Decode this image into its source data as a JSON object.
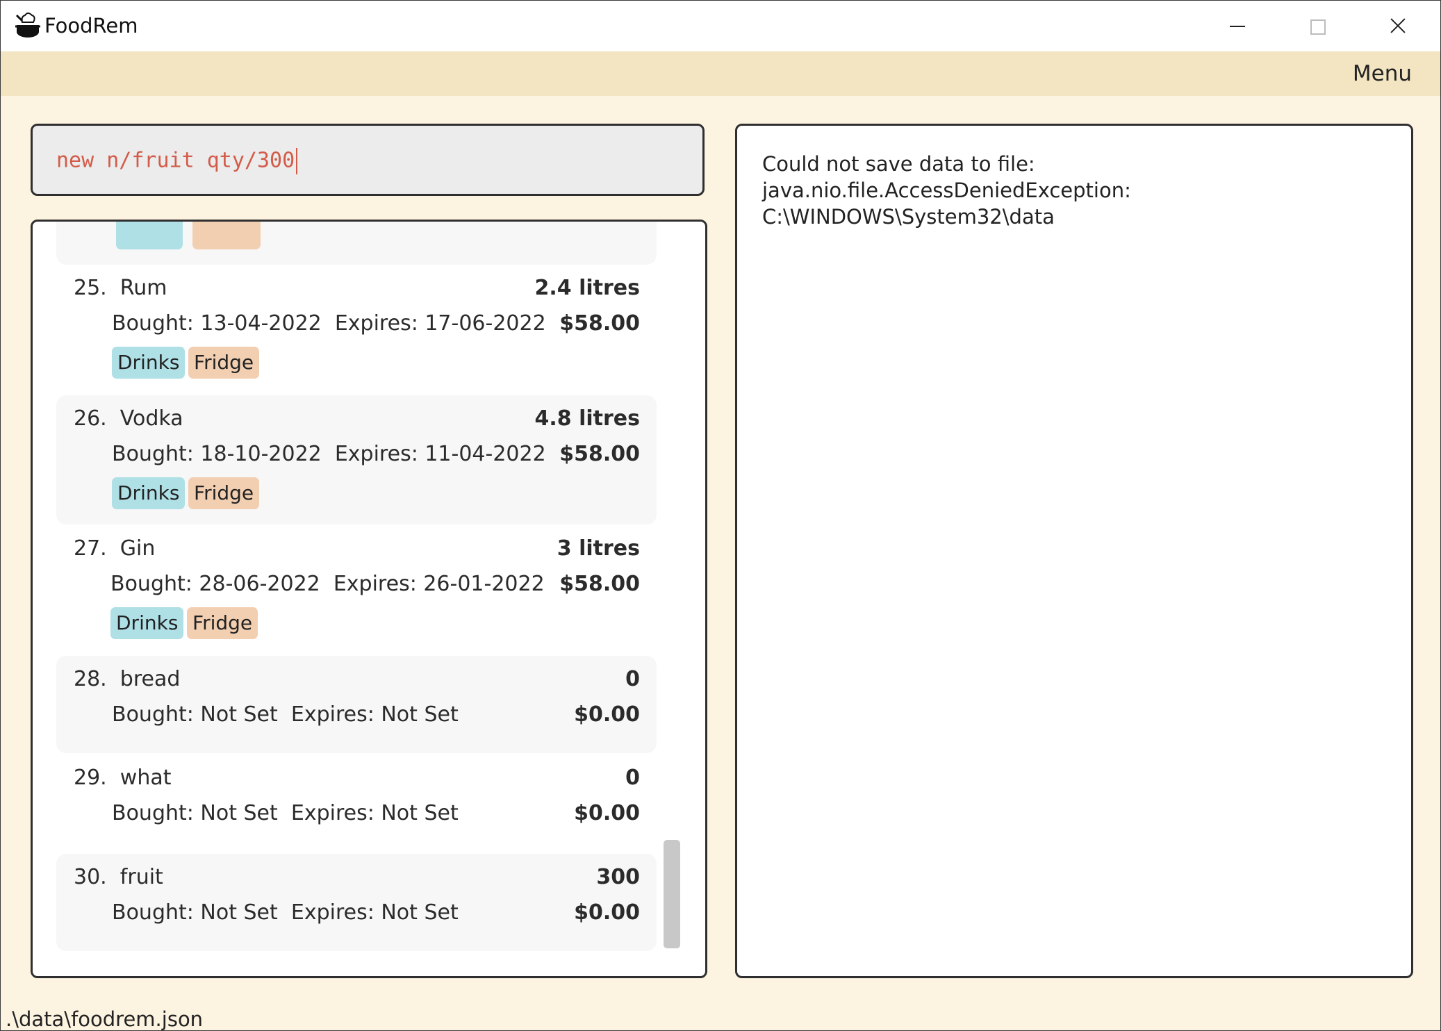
{
  "window": {
    "title": "FoodRem",
    "icon": "chef-pot-icon"
  },
  "menubar": {
    "menu_label": "Menu"
  },
  "command": {
    "value": "new n/fruit qty/300"
  },
  "result": {
    "line1": "Could not save data to file:",
    "line2": "java.nio.file.AccessDeniedException:",
    "line3": "C:\\WINDOWS\\System32\\data"
  },
  "items": [
    {
      "index": "25.",
      "name": "Rum",
      "quantity": "2.4 litres",
      "bought": "Bought: 13-04-2022",
      "expires": "Expires: 17-06-2022",
      "price": "$58.00",
      "tags": [
        "Drinks",
        "Fridge"
      ]
    },
    {
      "index": "26.",
      "name": "Vodka",
      "quantity": "4.8 litres",
      "bought": "Bought: 18-10-2022",
      "expires": "Expires: 11-04-2022",
      "price": "$58.00",
      "tags": [
        "Drinks",
        "Fridge"
      ]
    },
    {
      "index": "27.",
      "name": "Gin",
      "quantity": "3 litres",
      "bought": "Bought: 28-06-2022",
      "expires": "Expires: 26-01-2022",
      "price": "$58.00",
      "tags": [
        "Drinks",
        "Fridge"
      ]
    },
    {
      "index": "28.",
      "name": "bread",
      "quantity": "0",
      "bought": "Bought: Not Set",
      "expires": "Expires: Not Set",
      "price": "$0.00",
      "tags": []
    },
    {
      "index": "29.",
      "name": "what",
      "quantity": "0",
      "bought": "Bought: Not Set",
      "expires": "Expires: Not Set",
      "price": "$0.00",
      "tags": []
    },
    {
      "index": "30.",
      "name": "fruit",
      "quantity": "300",
      "bought": "Bought: Not Set",
      "expires": "Expires: Not Set",
      "price": "$0.00",
      "tags": []
    }
  ],
  "status": {
    "file_path": ".\\data\\foodrem.json"
  },
  "colors": {
    "accent_text": "#d25c49",
    "menubar_bg": "#f3e4c2",
    "app_bg": "#fdf3e1",
    "tag_drinks": "#aee0e6",
    "tag_fridge": "#f3cfb2"
  }
}
